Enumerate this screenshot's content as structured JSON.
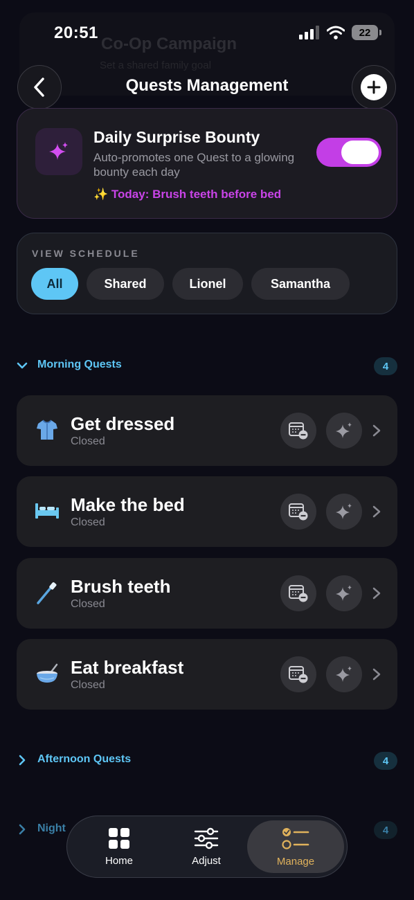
{
  "status": {
    "time": "20:51",
    "battery": "22"
  },
  "background_card": {
    "title": "Co-Op Campaign",
    "subtitle": "Set a shared family goal"
  },
  "header": {
    "title": "Quests Management"
  },
  "bounty": {
    "title": "Daily Surprise Bounty",
    "description": "Auto-promotes one Quest to a glowing bounty each day",
    "today": "✨ Today: Brush teeth before bed",
    "enabled": true
  },
  "schedule": {
    "label": "VIEW SCHEDULE",
    "chips": [
      "All",
      "Shared",
      "Lionel",
      "Samantha"
    ],
    "selected": "All"
  },
  "sections": [
    {
      "title": "Morning Quests",
      "count": "4",
      "expanded": true
    },
    {
      "title": "Afternoon Quests",
      "count": "4",
      "expanded": false
    },
    {
      "title": "Night Quests",
      "count": "4",
      "expanded": false
    }
  ],
  "night_visible_label": "Night",
  "quests": [
    {
      "name": "Get dressed",
      "status": "Closed",
      "icon": "shirt-icon"
    },
    {
      "name": "Make the bed",
      "status": "Closed",
      "icon": "bed-icon"
    },
    {
      "name": "Brush teeth",
      "status": "Closed",
      "icon": "toothbrush-icon"
    },
    {
      "name": "Eat breakfast",
      "status": "Closed",
      "icon": "bowl-icon"
    }
  ],
  "tabs": [
    {
      "label": "Home",
      "icon": "grid-icon"
    },
    {
      "label": "Adjust",
      "icon": "sliders-icon"
    },
    {
      "label": "Manage",
      "icon": "checklist-icon",
      "active": true
    }
  ],
  "colors": {
    "accent_blue": "#5ec6f5",
    "accent_purple": "#c944e8",
    "accent_gold": "#e0b25c",
    "background": "#0c0c16"
  }
}
